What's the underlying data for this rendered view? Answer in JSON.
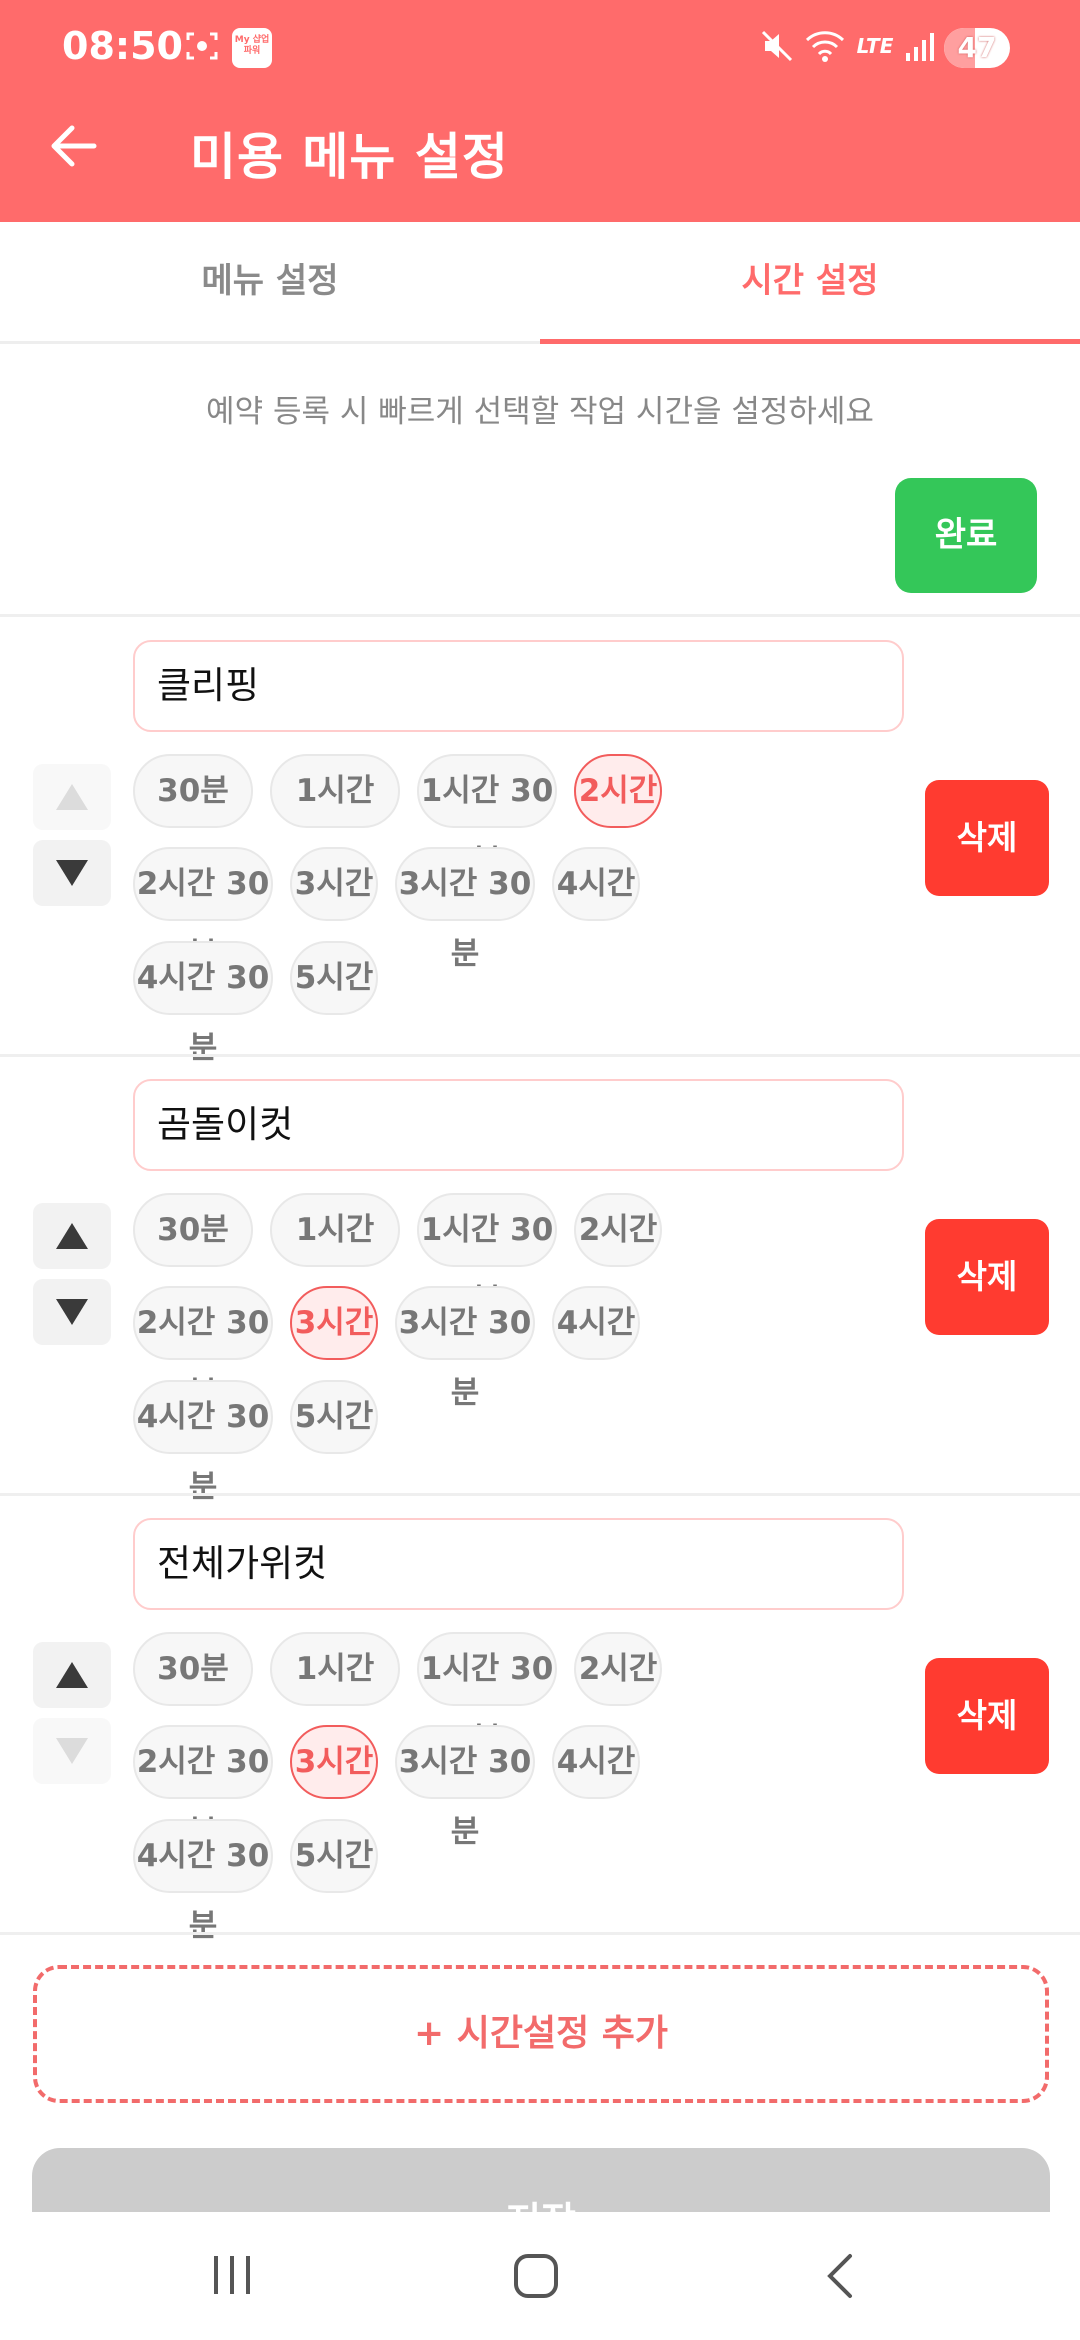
{
  "status_bar": {
    "time": "08:50",
    "app_badge": "My 샵업파워",
    "battery": "47",
    "battery_level": 0.47
  },
  "app_bar": {
    "title": "미용 메뉴 설정"
  },
  "tabs": [
    {
      "label": "메뉴 설정",
      "active": false
    },
    {
      "label": "시간 설정",
      "active": true
    }
  ],
  "hint": "예약 등록 시 빠르게 선택할 작업 시간을 설정하세요",
  "done_button": "완료",
  "entries": [
    {
      "name": "클리핑",
      "up_enabled": false,
      "down_enabled": true,
      "options": [
        "30분",
        "1시간",
        "1시간 30분",
        "2시간",
        "2시간 30분",
        "3시간",
        "3시간 30분",
        "4시간",
        "4시간 30분",
        "5시간"
      ],
      "selected": "2시간",
      "delete_label": "삭제"
    },
    {
      "name": "곰돌이컷",
      "up_enabled": true,
      "down_enabled": true,
      "options": [
        "30분",
        "1시간",
        "1시간 30분",
        "2시간",
        "2시간 30분",
        "3시간",
        "3시간 30분",
        "4시간",
        "4시간 30분",
        "5시간"
      ],
      "selected": "3시간",
      "delete_label": "삭제"
    },
    {
      "name": "전체가위컷",
      "up_enabled": true,
      "down_enabled": false,
      "options": [
        "30분",
        "1시간",
        "1시간 30분",
        "2시간",
        "2시간 30분",
        "3시간",
        "3시간 30분",
        "4시간",
        "4시간 30분",
        "5시간"
      ],
      "selected": "3시간",
      "delete_label": "삭제"
    }
  ],
  "add_button": "+ 시간설정 추가",
  "save_button": "저장",
  "colors": {
    "primary": "#FF6B6B",
    "done": "#34C759",
    "delete": "#FF3B30",
    "selected_chip": "#F25C5C"
  }
}
